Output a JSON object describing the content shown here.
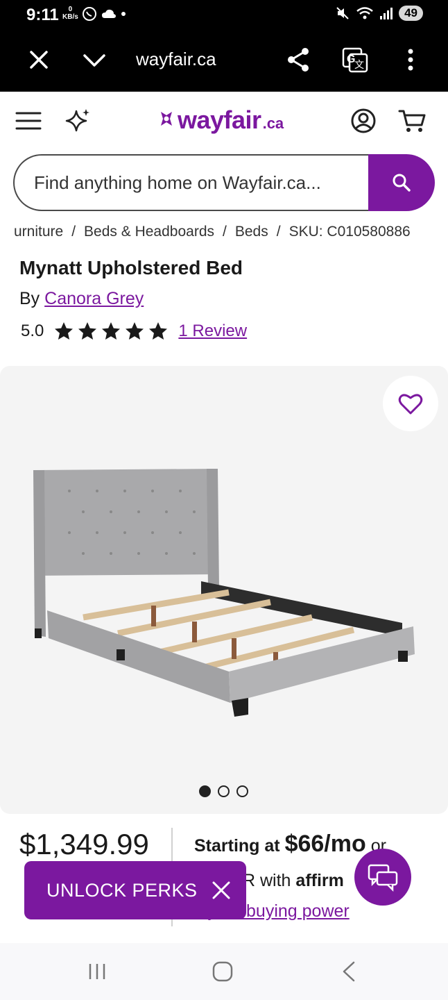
{
  "status_bar": {
    "time": "9:11",
    "net_speed": "0",
    "net_unit": "KB/s",
    "battery": "49"
  },
  "browser": {
    "url": "wayfair.ca"
  },
  "header": {
    "logo_word": "wayfair",
    "logo_suffix": ".ca",
    "brand_color": "#7b189f"
  },
  "search": {
    "placeholder": "Find anything home on Wayfair.ca..."
  },
  "breadcrumb": {
    "items": [
      "urniture",
      "Beds & Headboards",
      "Beds",
      "SKU: C010580886"
    ]
  },
  "product": {
    "title": "Mynatt Upholstered Bed",
    "by_prefix": "By",
    "brand": "Canora Grey",
    "rating": "5.0",
    "stars": 5,
    "review_link": "1 Review",
    "image_count": 3,
    "active_image": 1
  },
  "pricing": {
    "price": "$1,349.99",
    "starting_at": "Starting at",
    "monthly": "$66/mo",
    "or": "or",
    "apr_text": "R with",
    "affirm": "affirm",
    "buying_power_link": "k your buying power"
  },
  "promo": {
    "unlock_label": "UNLOCK PERKS"
  }
}
